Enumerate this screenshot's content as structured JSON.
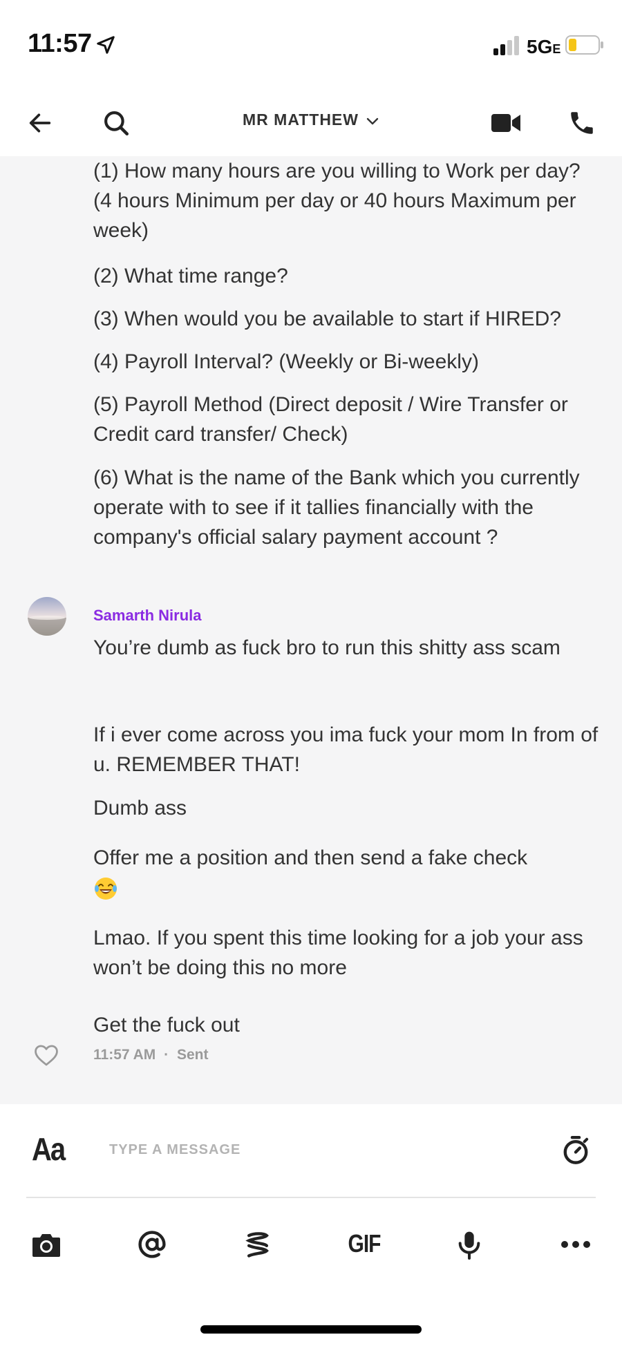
{
  "status_bar": {
    "time": "11:57",
    "network": "5G",
    "network_sub": "E",
    "battery_color": "#f5c518"
  },
  "header": {
    "title": "MR MATTHEW"
  },
  "messages_incoming_tail": [
    "(1) How many hours are you willing to Work per day? (4 hours Minimum per day or 40 hours Maximum per week)",
    "(2) What time range?",
    "(3) When would you be available to start if HIRED?",
    "(4) Payroll Interval? (Weekly or Bi-weekly)",
    "(5) Payroll Method (Direct deposit / Wire Transfer or Credit card transfer/ Check)",
    "(6) What is the name of the Bank which you currently operate with to see if it tallies financially with the company's official salary payment account ?"
  ],
  "sender": {
    "name": "Samarth Nirula",
    "color": "#8a2be2"
  },
  "sent_messages": [
    "You’re dumb as fuck bro to run this shitty ass scam",
    "If i ever come across you ima fuck your mom In from of u. REMEMBER THAT!",
    "Dumb ass",
    "Offer me a position and then send a fake check",
    "Lmao. If you spent this time looking for a job your ass won’t be doing this no more",
    "Get the fuck out"
  ],
  "emoji": "face-with-tears-of-joy",
  "meta": {
    "time": "11:57 AM",
    "separator": "·",
    "status": "Sent"
  },
  "composer": {
    "aa_label": "Aa",
    "placeholder": "TYPE A MESSAGE",
    "value": "",
    "gif_label": "GIF"
  },
  "icons": {
    "back": "arrow-left-icon",
    "search": "search-icon",
    "video": "video-camera-icon",
    "phone": "phone-icon",
    "chevron": "chevron-down-icon",
    "heart": "heart-icon",
    "timer": "timer-icon",
    "camera": "camera-icon",
    "mention": "at-icon",
    "snippet": "stack-icon",
    "mic": "microphone-icon",
    "more": "more-icon"
  }
}
